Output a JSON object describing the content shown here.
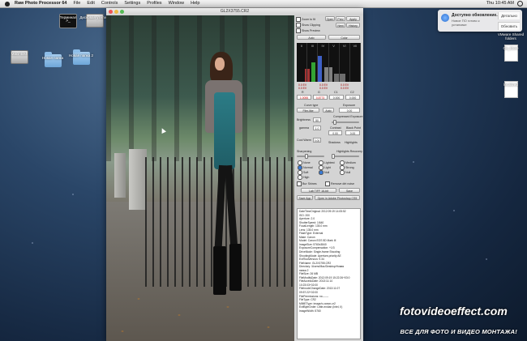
{
  "menubar": {
    "app_name": "Raw Photo Processor 64",
    "items": [
      "File",
      "Edit",
      "Controls",
      "Settings",
      "Profiles",
      "Window",
      "Help"
    ],
    "clock": "Thu 10:45 AM"
  },
  "desktop": {
    "left_icons": [
      {
        "label": "Терминал",
        "kind": "terminal",
        "glyph": ">_"
      },
      {
        "label": "Дисковая утилита",
        "kind": "disk"
      },
      {
        "label": "Macintosh",
        "kind": "drive"
      },
      {
        "label": "Новая папка",
        "kind": "folder"
      },
      {
        "label": "Новая папка 2",
        "kind": "folder"
      }
    ],
    "right_icons": [
      {
        "label": "VMware Shared folders",
        "kind": "folder"
      },
      {
        "label": "Os_Store",
        "kind": "document"
      },
      {
        "label": "localized",
        "kind": "document"
      }
    ]
  },
  "notification": {
    "title": "Доступно обновление...",
    "subtitle": "Новое ПО готово к установке",
    "btn_details": "Детально",
    "btn_update": "Обновить"
  },
  "window": {
    "title": "GL2X3755.CR2"
  },
  "panel": {
    "checks": [
      "Zoom to fit",
      "Show Clipping",
      "Show Preview"
    ],
    "top_buttons": [
      "Open",
      "Prev",
      "Apply",
      "Next",
      "History"
    ],
    "mode_buttons": [
      "Auto",
      "Color"
    ],
    "histo_zones": [
      "II",
      "III",
      "IV",
      "V",
      "VI",
      "VII"
    ],
    "vals": [
      "0.0 EV",
      "0.0 EV",
      "0.0 EV",
      "0.0 EV",
      "0.0 EV",
      "0.0 EV"
    ],
    "rgb_labels": [
      "R",
      "G",
      "B",
      "C1",
      "C2"
    ],
    "rgb_values": [
      "1.0055",
      "0.8773",
      "0.000",
      "0.000"
    ],
    "curve_label": "Curve type",
    "curve_value": "Film-like",
    "auto_label": "Auto",
    "exposure_label": "Exposure",
    "exposure_value": "0.00",
    "brightness_label": "Brightness",
    "brightness_value": "50",
    "compressed_label": "Compressed Exposure",
    "gamma_label": "gamma",
    "gamma_value": "1.0",
    "shadows_label": "Contrast",
    "blackpoint_label": "Black Point",
    "contrast_value": "0.00",
    "blackpoint_value": "0.00",
    "coolwarm_label": "Cool Warm",
    "coolwarm_value": "0.00",
    "shadows2_label": "Shadows",
    "highlights_label": "Highlights",
    "recovery_label": "Highlights Recovery",
    "sharpening_label": "Sharpening",
    "sharpening_options": [
      "None",
      "Normal",
      "Soft",
      "High"
    ],
    "radios": [
      "Lightest",
      "Light",
      "Null"
    ],
    "radios_right": [
      "Medium",
      "Strong",
      "Null"
    ],
    "chk_row": [
      "Bur Shines",
      "Remove dirt noise"
    ],
    "format_btn": "Lab TIFF 16-bit",
    "save_btn": "Save",
    "open_btn": "Save App",
    "open_in": "Open in Adobe Photoshop CS5",
    "exif": [
      "DateTimeOriginal: 2012:09:19 14:05:52",
      "ISO: 200",
      "Aperture: 2.0",
      "ShutterSpeed: 1/640",
      "FocalLength: 135.0 mm",
      "Lens: 135.0 mm",
      "FlashType: External",
      "Make: Canon",
      "Model: Canon EOS 5D Mark III",
      "ImageSize: 5760x3840",
      "ExposureCompensation: +1/3",
      "DriveMode: Single-frame Shooting",
      "ShootingMode: Aperture-priority AE",
      "ExifToolVersion: 9.34",
      "FileName: GL2X3755.CR2",
      "Directory: /Users/Mac/Desktop/Новая",
      "папка 2",
      "FileSize: 26 MB",
      "FileModifyDate: 2012:09:19 15:22:26+03:0",
      "FileAccessDate: 2013:11:14",
      "10:23:03+02:00",
      "FileInodeChangeDate: 2013:11:07",
      "09:57:22+02:00",
      "FilePermissions: rw-------",
      "FileType: CR2",
      "MIMEType: image/x-canon-cr2",
      "ExifByteOrder: Little-endian (Intel, II)",
      "ImageWidth: 5760"
    ]
  },
  "watermark": {
    "main": "fotovideoeffect.com",
    "sub": "ВСЕ ДЛЯ ФОТО И ВИДЕО МОНТАЖА!"
  },
  "colors": {
    "panel_bg": "#d4d4d4",
    "desktop_bg": "#1d3350",
    "menubar_bg": "#e6e6e6"
  }
}
